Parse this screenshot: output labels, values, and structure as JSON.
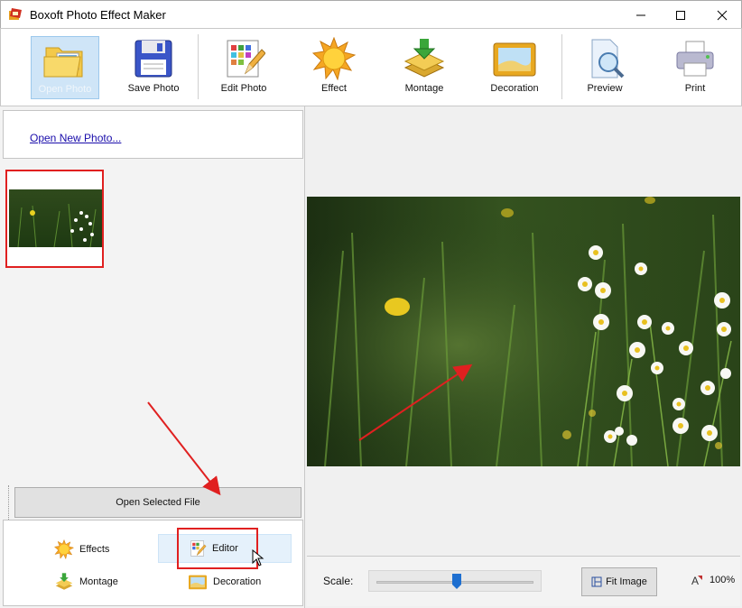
{
  "window": {
    "title": "Boxoft Photo Effect Maker"
  },
  "toolbar": {
    "open_photo": "Open Photo",
    "save_photo": "Save Photo",
    "edit_photo": "Edit Photo",
    "effect": "Effect",
    "montage": "Montage",
    "decoration": "Decoration",
    "preview": "Preview",
    "print": "Print"
  },
  "left": {
    "open_new_photo": "Open New Photo...",
    "open_selected_file": "Open Selected File",
    "bottom_buttons": {
      "effects": "Effects",
      "editor": "Editor",
      "montage": "Montage",
      "decoration": "Decoration"
    }
  },
  "viewer": {
    "scale_label": "Scale:",
    "scale_fraction": 0.51,
    "fit_image": "Fit Image",
    "zoom": "100%"
  },
  "colors": {
    "annotation_red": "#e02020",
    "selected_bg": "#cfe5f7",
    "link": "#1a0dab"
  }
}
